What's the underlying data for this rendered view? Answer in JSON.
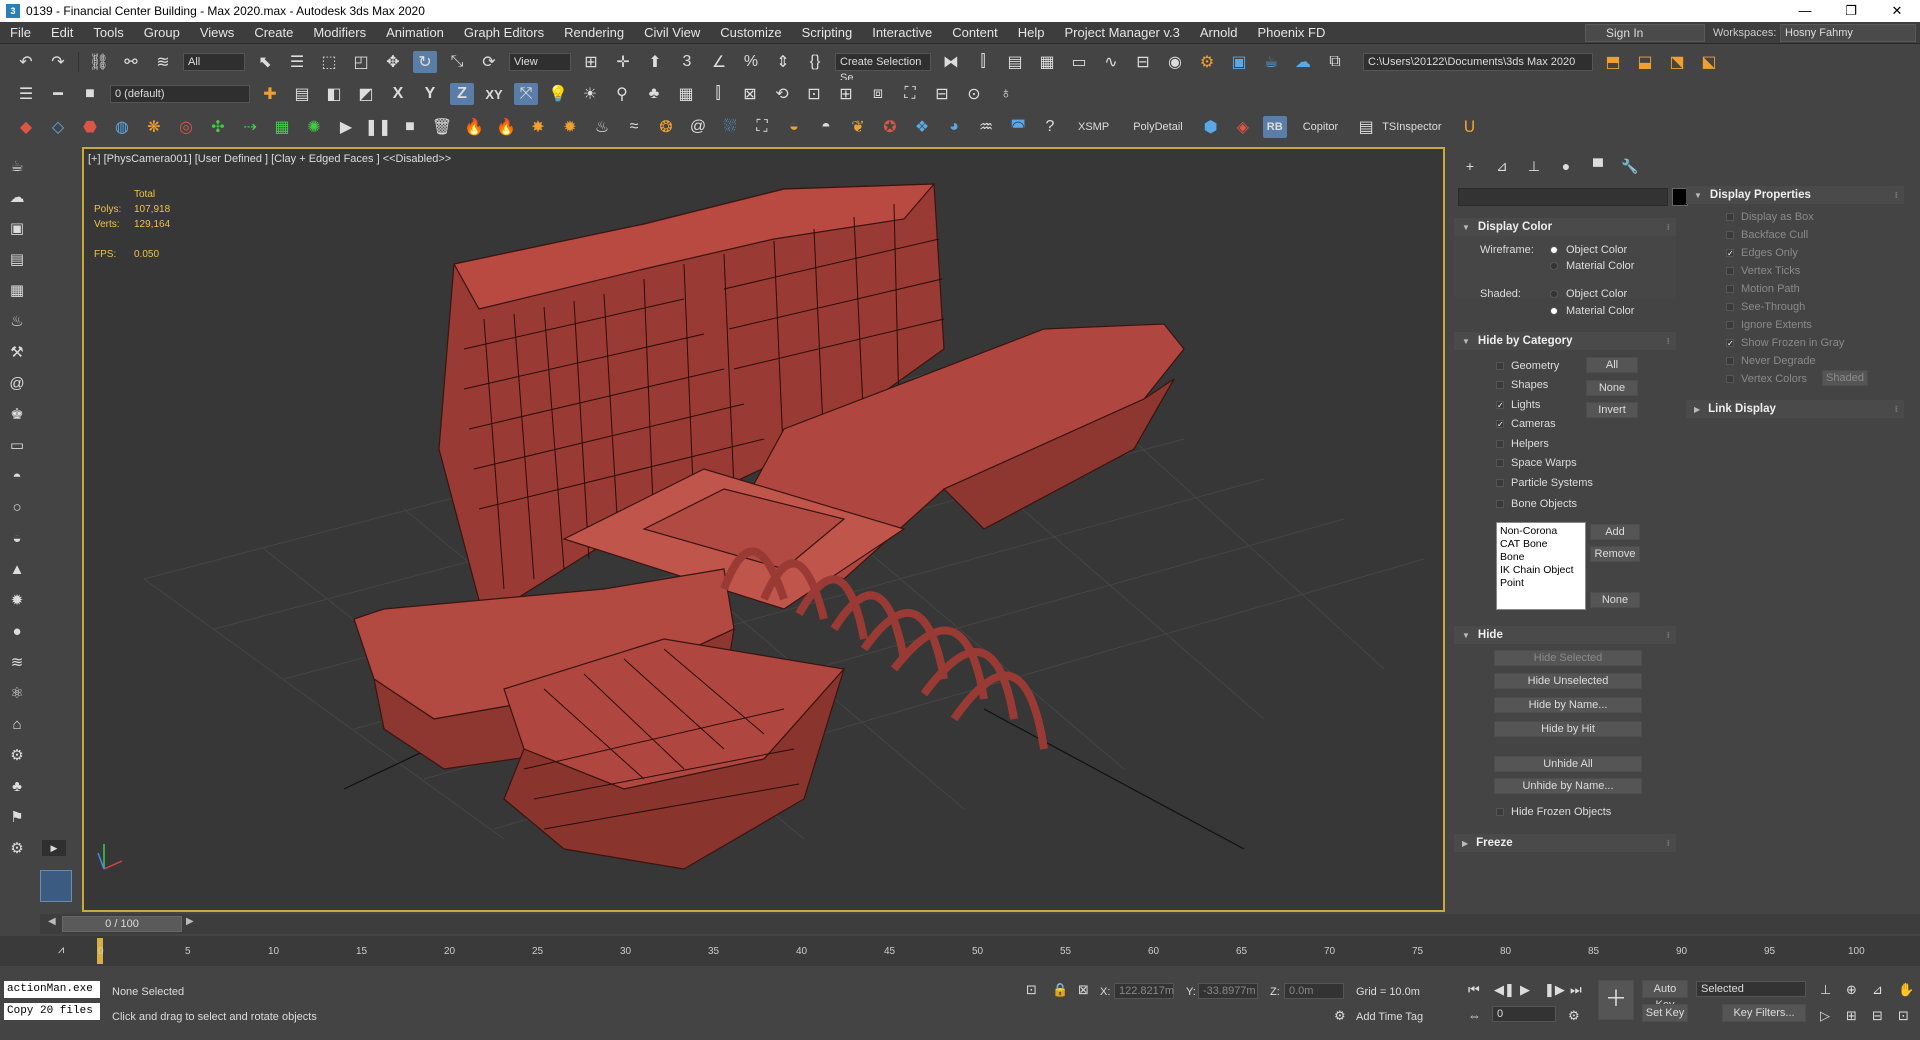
{
  "window": {
    "title": "0139 - Financial Center Building - Max 2020.max - Autodesk 3ds Max 2020",
    "logo": "3",
    "minimize": "—",
    "maximize": "❐",
    "close": "✕"
  },
  "menu": {
    "items": [
      "File",
      "Edit",
      "Tools",
      "Group",
      "Views",
      "Create",
      "Modifiers",
      "Animation",
      "Graph Editors",
      "Rendering",
      "Civil View",
      "Customize",
      "Scripting",
      "Interactive",
      "Content",
      "Help",
      "Project Manager v.3",
      "Arnold",
      "Phoenix FD"
    ],
    "sign_in": "Sign In",
    "workspaces_label": "Workspaces:",
    "workspace_value": "Hosny Fahmy"
  },
  "toolbar_main": {
    "selection_filter": "All",
    "ref_coord": "View",
    "create_selection_set": "Create Selection Se",
    "project_path": "C:\\Users\\20122\\Documents\\3ds Max 2020"
  },
  "toolbar_layer": {
    "layer_name": "0 (default)",
    "axis_x": "X",
    "axis_y": "Y",
    "axis_z": "Z",
    "axis_xy": "XY"
  },
  "toolbar_plugins": {
    "xsmp": "XSMP",
    "polydetail": "PolyDetail",
    "rb": "RB",
    "copitor": "Copitor",
    "tsinspector": "TSInspector"
  },
  "viewport": {
    "label": "[+] [PhysCamera001] [User Defined ] [Clay + Edged Faces ]  <<Disabled>>",
    "stats": {
      "total_label": "Total",
      "polys_label": "Polys:",
      "polys_value": "107,918",
      "verts_label": "Verts:",
      "verts_value": "129,164",
      "fps_label": "FPS:",
      "fps_value": "0.050"
    }
  },
  "cmdpanel": {
    "display_properties": {
      "title": "Display Properties",
      "options": [
        {
          "label": "Display as Box",
          "checked": false
        },
        {
          "label": "Backface Cull",
          "checked": false
        },
        {
          "label": "Edges Only",
          "checked": true
        },
        {
          "label": "Vertex Ticks",
          "checked": false
        },
        {
          "label": "Motion Path",
          "checked": false
        },
        {
          "label": "See-Through",
          "checked": false
        },
        {
          "label": "Ignore Extents",
          "checked": false
        },
        {
          "label": "Show Frozen in Gray",
          "checked": true
        },
        {
          "label": "Never Degrade",
          "checked": false
        },
        {
          "label": "Vertex Colors",
          "checked": false
        }
      ],
      "shaded_button": "Shaded"
    },
    "link_display": {
      "title": "Link Display"
    },
    "display_color": {
      "title": "Display Color",
      "wireframe_label": "Wireframe:",
      "shaded_label": "Shaded:",
      "object_color": "Object Color",
      "material_color": "Material Color"
    },
    "hide_by_category": {
      "title": "Hide by Category",
      "categories": [
        {
          "label": "Geometry",
          "checked": false
        },
        {
          "label": "Shapes",
          "checked": false
        },
        {
          "label": "Lights",
          "checked": true
        },
        {
          "label": "Cameras",
          "checked": true
        },
        {
          "label": "Helpers",
          "checked": false
        },
        {
          "label": "Space Warps",
          "checked": false
        },
        {
          "label": "Particle Systems",
          "checked": false
        },
        {
          "label": "Bone Objects",
          "checked": false
        }
      ],
      "btn_all": "All",
      "btn_none": "None",
      "btn_invert": "Invert",
      "list": [
        "Non-Corona",
        "CAT Bone",
        "Bone",
        "IK Chain Object",
        "Point"
      ],
      "btn_add": "Add",
      "btn_remove": "Remove",
      "btn_list_none": "None"
    },
    "hide": {
      "title": "Hide",
      "hide_selected": "Hide Selected",
      "hide_unselected": "Hide Unselected",
      "hide_by_name": "Hide by Name...",
      "hide_by_hit": "Hide by Hit",
      "unhide_all": "Unhide All",
      "unhide_by_name": "Unhide by Name...",
      "hide_frozen": "Hide Frozen Objects"
    },
    "freeze": {
      "title": "Freeze"
    }
  },
  "timeline": {
    "slider_label": "0 / 100",
    "ticks": [
      "0",
      "5",
      "10",
      "15",
      "20",
      "25",
      "30",
      "35",
      "40",
      "45",
      "50",
      "55",
      "60",
      "65",
      "70",
      "75",
      "80",
      "85",
      "90",
      "95",
      "100"
    ]
  },
  "status": {
    "maxscript_top": "actionMan.exe",
    "maxscript_bottom": "Copy 20 files",
    "selection": "None Selected",
    "prompt": "Click and drag to select and rotate objects",
    "x_label": "X:",
    "x_value": "122.8217m",
    "y_label": "Y:",
    "y_value": "-33.8977m",
    "z_label": "Z:",
    "z_value": "0.0m",
    "grid": "Grid = 10.0m",
    "add_time_tag": "Add Time Tag",
    "auto_key": "Auto Key",
    "set_key": "Set Key",
    "key_mode": "Selected",
    "key_filters": "Key Filters...",
    "frame": "0"
  }
}
